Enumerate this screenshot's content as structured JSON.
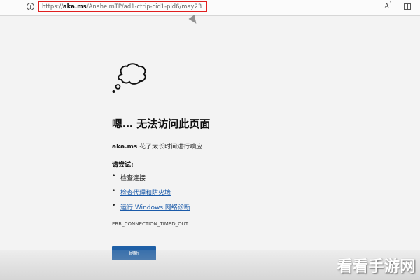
{
  "toolbar": {
    "url_scheme": "https://",
    "url_domain": "aka.ms",
    "url_path": "/AnaheimTP/ad1-ctrip-cid1-pid6/may23",
    "read_aloud_icon_glyph": "A",
    "read_aloud_icon_marks": "ˇ"
  },
  "error_page": {
    "heading": "嗯… 无法访问此页面",
    "message_domain": "aka.ms",
    "message_text": " 花了太长时间进行响应",
    "try_title": "请尝试:",
    "suggestions": [
      {
        "label": "检查连接",
        "is_link": false
      },
      {
        "label": "检查代理和防火墙",
        "is_link": true
      },
      {
        "label": "运行 Windows 网络诊断",
        "is_link": true
      }
    ],
    "error_code": "ERR_CONNECTION_TIMED_OUT",
    "refresh_label": "刷新"
  },
  "watermark": {
    "text": "看看手游网"
  },
  "colors": {
    "accent": "#1e5fa6",
    "link": "#1a5aa9",
    "url_highlight_border": "#e01f1f",
    "background": "#f3f3f3"
  },
  "icons": {
    "info": "info-icon",
    "read_aloud": "read-aloud-icon",
    "split_view": "split-screen-icon",
    "cloud": "thought-cloud-icon",
    "cursor": "mouse-cursor-icon"
  }
}
